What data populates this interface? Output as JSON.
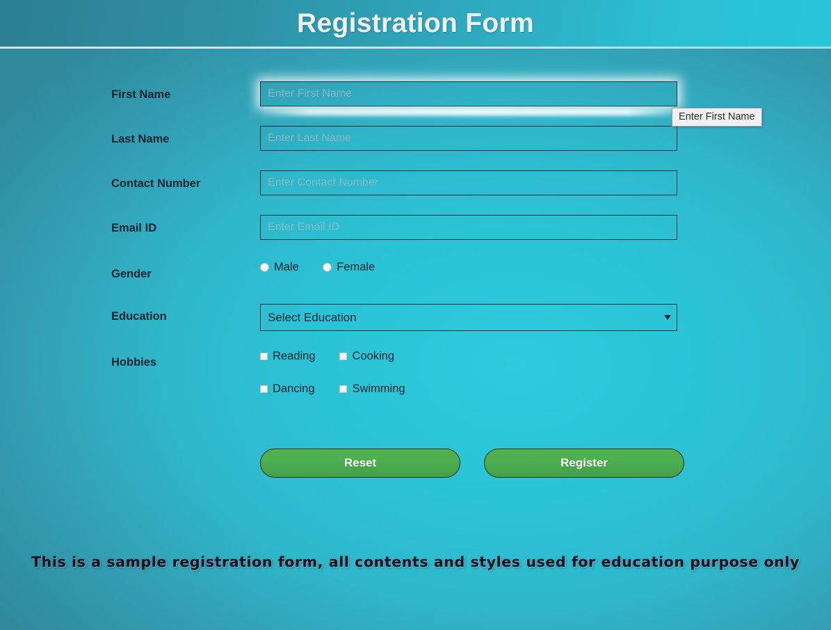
{
  "header": {
    "title": "Registration Form"
  },
  "form": {
    "rows": [
      {
        "label": "First Name",
        "placeholder": "Enter First Name"
      },
      {
        "label": "Last Name",
        "placeholder": "Enter Last Name"
      },
      {
        "label": "Contact Number",
        "placeholder": "Enter Contact Number"
      },
      {
        "label": "Email ID",
        "placeholder": "Enter Email ID"
      }
    ],
    "gender": {
      "label": "Gender",
      "options": [
        {
          "label": "Male",
          "selected": false
        },
        {
          "label": "Female",
          "selected": false
        }
      ]
    },
    "education": {
      "label": "Education",
      "selected": "Select Education",
      "arrow_icon": "chevron-down-icon"
    },
    "hobbies": {
      "label": "Hobbies",
      "options": [
        {
          "label": "Reading",
          "checked": false
        },
        {
          "label": "Cooking",
          "checked": false
        },
        {
          "label": "Dancing",
          "checked": false
        },
        {
          "label": "Swimming",
          "checked": false
        }
      ]
    },
    "buttons": {
      "reset": "Reset",
      "register": "Register"
    }
  },
  "validation_tooltip": {
    "message": "Enter First Name"
  },
  "footer": {
    "note": "This is a sample registration form, all contents and styles used for education purpose only"
  },
  "colors": {
    "header_gradient_start": "#2d7f92",
    "header_gradient_end": "#29c6da",
    "background_center": "#2ecadd",
    "background_edge": "#2f8a9c",
    "title_text": "#efefef",
    "label_text": "#10242e",
    "field_border": "#1d3038",
    "placeholder_text": "#8fb9c2",
    "button_green": "#4caf50",
    "tooltip_background": "#f0f0f0",
    "footer_text": "#1a1020"
  }
}
